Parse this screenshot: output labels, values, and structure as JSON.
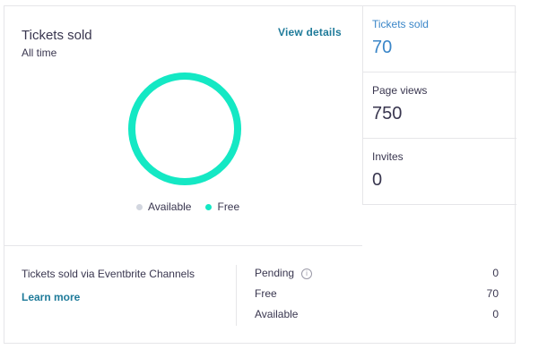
{
  "main": {
    "title": "Tickets sold",
    "subtitle": "All time",
    "view_details": "View details"
  },
  "chart_data": {
    "type": "pie",
    "categories": [
      "Available",
      "Free"
    ],
    "values": [
      0,
      70
    ],
    "colors": [
      "#d2d6df",
      "#14e8c4"
    ],
    "title": "Tickets sold",
    "subtitle": "All time",
    "legend": "bottom"
  },
  "legend": [
    {
      "label": "Available",
      "color": "#d2d6df"
    },
    {
      "label": "Free",
      "color": "#14e8c4"
    }
  ],
  "stats": [
    {
      "label": "Tickets sold",
      "value": "70",
      "active": true
    },
    {
      "label": "Page views",
      "value": "750",
      "active": false
    },
    {
      "label": "Invites",
      "value": "0",
      "active": false
    }
  ],
  "bottom": {
    "channels_text": "Tickets sold via Eventbrite Channels",
    "learn_more": "Learn more",
    "rows": [
      {
        "label": "Pending",
        "value": "0",
        "info_icon": "info-icon"
      },
      {
        "label": "Free",
        "value": "70"
      },
      {
        "label": "Available",
        "value": "0"
      }
    ]
  },
  "colors": {
    "accent": "#1f7b9a",
    "stat_active": "#3a86c8",
    "donut_free": "#14e8c4",
    "donut_available": "#d2d6df"
  }
}
